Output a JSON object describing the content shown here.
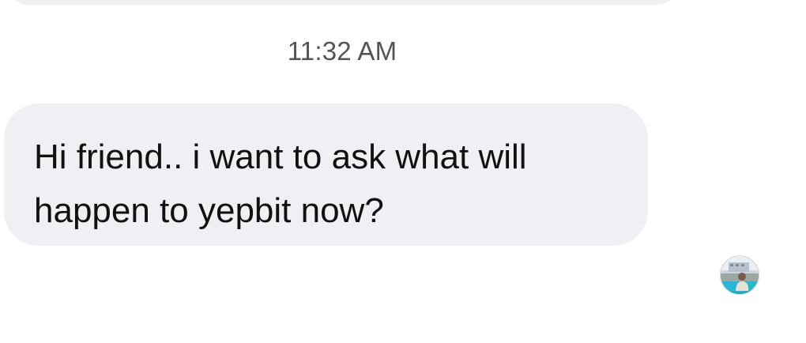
{
  "chat": {
    "timestamp": "11:32 AM",
    "message": {
      "text": "Hi friend.. i want to ask what will\nhappen to yepbit now?",
      "bubble_color": "#f0f0f4"
    },
    "avatar": {
      "icon": "contact-avatar-photo"
    }
  }
}
